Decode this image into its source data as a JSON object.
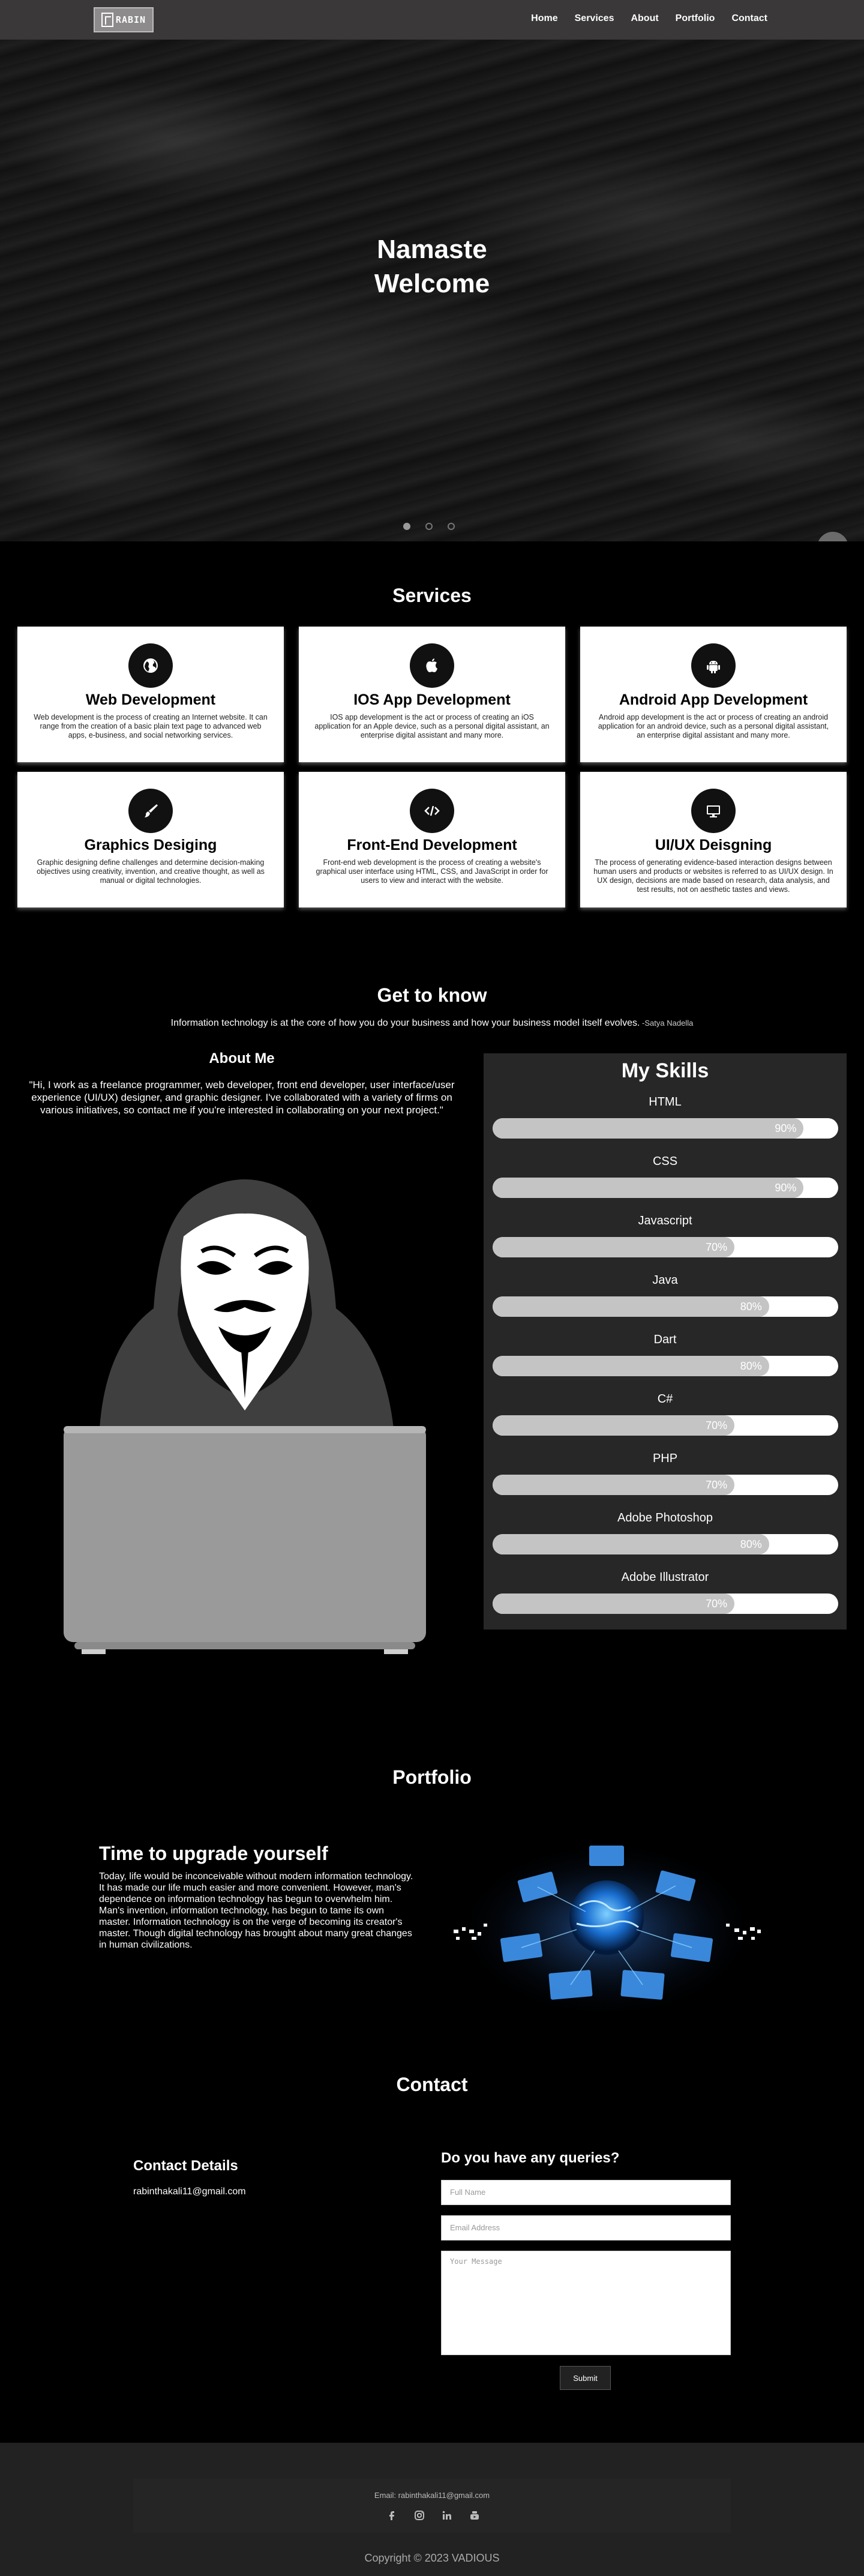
{
  "nav": {
    "logo_text": "RABIN",
    "items": [
      "Home",
      "Services",
      "About",
      "Portfolio",
      "Contact"
    ]
  },
  "hero": {
    "line1": "Namaste",
    "line2": "Welcome",
    "slides": 3,
    "active_slide": 1
  },
  "services": {
    "title": "Services",
    "cards": [
      {
        "title": "Web Development",
        "icon": "globe-icon",
        "text": "Web development is the process of creating an Internet website. It can range from the creation of a basic plain text page to advanced web apps, e-business, and social networking services."
      },
      {
        "title": "IOS App Development",
        "icon": "apple-icon",
        "text": "IOS app development is the act or process of creating an iOS application for an Apple device, such as a personal digital assistant, an enterprise digital assistant and many more."
      },
      {
        "title": "Android App Development",
        "icon": "android-icon",
        "text": "Android app development is the act or process of creating an android application for an android device, such as a personal digital assistant, an enterprise digital assistant and many more."
      },
      {
        "title": "Graphics Desiging",
        "icon": "brush-icon",
        "text": "Graphic designing define challenges and determine decision-making objectives using creativity, invention, and creative thought, as well as manual or digital technologies."
      },
      {
        "title": "Front-End Development",
        "icon": "code-icon",
        "text": "Front-end web development is the process of creating a website's graphical user interface using HTML, CSS, and JavaScript in order for users to view and interact with the website."
      },
      {
        "title": "UI/UX Deisgning",
        "icon": "desktop-icon",
        "text": "The process of generating evidence-based interaction designs between human users and products or websites is referred to as UI/UX design. In UX design, decisions are made based on research, data analysis, and test results, not on aesthetic tastes and views."
      }
    ]
  },
  "know": {
    "title": "Get to know",
    "quote": "Information technology is at the core of how you do your business and how your business model itself evolves.",
    "quote_by": " -Satya Nadella"
  },
  "about": {
    "title": "About Me",
    "text": "\"Hi, I work as a freelance programmer, web developer, front end developer, user interface/user experience (UI/UX) designer, and graphic designer. I've collaborated with a variety of firms on various initiatives, so contact me if you're interested in collaborating on your next project.\""
  },
  "skills": {
    "title": "My Skills",
    "items": [
      {
        "name": "HTML",
        "value": 90,
        "label": "90%"
      },
      {
        "name": "CSS",
        "value": 90,
        "label": "90%"
      },
      {
        "name": "Javascript",
        "value": 70,
        "label": "70%"
      },
      {
        "name": "Java",
        "value": 80,
        "label": "80%"
      },
      {
        "name": "Dart",
        "value": 80,
        "label": "80%"
      },
      {
        "name": "C#",
        "value": 70,
        "label": "70%"
      },
      {
        "name": "PHP",
        "value": 70,
        "label": "70%"
      },
      {
        "name": "Adobe Photoshop",
        "value": 80,
        "label": "80%"
      },
      {
        "name": "Adobe Illustrator",
        "value": 70,
        "label": "70%"
      }
    ]
  },
  "portfolio": {
    "title": "Portfolio",
    "heading": "Time to upgrade yourself",
    "text": "Today, life would be inconceivable without modern information technology. It has made our life much easier and more convenient. However, man's dependence on information technology has begun to overwhelm him. Man's invention, information technology, has begun to tame its own master. Information technology is on the verge of becoming its creator's master. Though digital technology has brought about many great changes in human civilizations."
  },
  "contact": {
    "title": "Contact",
    "details_title": "Contact Details",
    "email": "rabinthakali11@gmail.com",
    "form_title": "Do you have any queries?",
    "name_placeholder": "Full Name",
    "email_placeholder": "Email Address",
    "message_placeholder": "Your Message",
    "submit_label": "Submit"
  },
  "footer": {
    "email": "Email: rabinthakali11@gmail.com",
    "socials": [
      "facebook-icon",
      "instagram-icon",
      "linkedin-icon",
      "youtube-icon"
    ],
    "copyright": "Copyright © 2023 VADIOUS"
  },
  "colors": {
    "nav_bg": "#3a3838",
    "page_bg": "#000000",
    "card_bg": "#ffffff",
    "skills_bg": "#272727",
    "bar_fill": "#c4c4c4",
    "footer_bg": "#222222"
  }
}
